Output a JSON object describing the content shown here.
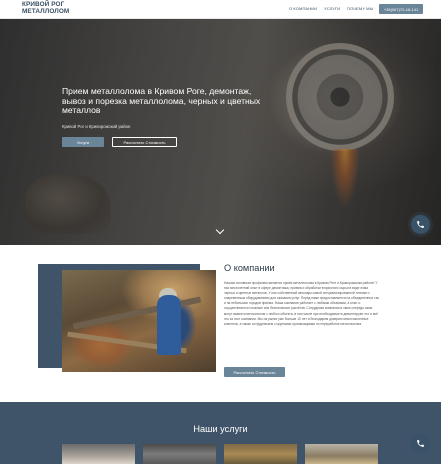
{
  "header": {
    "logo_line1": "КРИВОЙ РОГ",
    "logo_line2": "МЕТАЛЛОЛОМ",
    "nav": [
      "О КОМПАНИИ",
      "УСЛУГИ",
      "ПОЧЕМУ МЫ"
    ],
    "phone": "+38(067)70-18-141"
  },
  "hero": {
    "title": "Прием металлолома в Кривом Роге, демонтаж, вывоз и порезка металлолома, черных и цветных металлов",
    "subtitle": "Кривой Рог и Криворожский район",
    "btn_primary": "Услуги",
    "btn_secondary": "Рассчитать Стоимость"
  },
  "about": {
    "title": "О компании",
    "text": "Нашим основным профилем является прием металлолома в Кривом Роге и Криворожском районе! У нас многолетний опыт в сфере демонтажа, приема и обработки вторичного сырья в виде лома черных и цветных металлов. У нас собственный автопарк самой специализированной техники с современным оборудованием для оказания услуг. Перед нами предоставляется на объединенных так и на небольших городов приема. Наша компания работает с любыми объемами, а опыт и осуществляется сложные или безналичные расчётов. Сотрудники компании в свою очередь сами могут вывезти металлолом с любого объекта, в том числе при необходимости демонтируют его и всё это за счет компании. Мы на рынке уже больше 10 лет и благодарим доверию многочисленных клиентов, а также сотрудничаем с крупными организациями по переработке металлолома.",
    "button": "Рассчитать Стоимость"
  },
  "services": {
    "title": "Наши услуги"
  },
  "colors": {
    "accent": "#6a8498",
    "dark_panel": "#3f5468",
    "fab": "#3a5268"
  },
  "icons": {
    "call": "phone-icon",
    "scroll": "chevron-down-icon"
  }
}
